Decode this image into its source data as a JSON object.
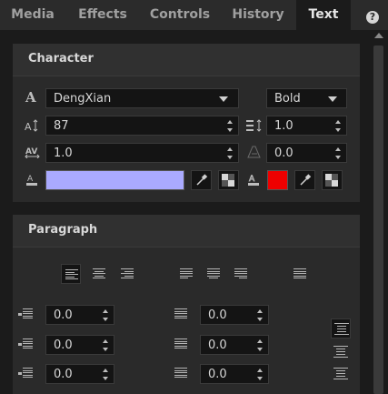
{
  "tabs": [
    {
      "label": "Media"
    },
    {
      "label": "Effects"
    },
    {
      "label": "Controls"
    },
    {
      "label": "History"
    },
    {
      "label": "Text",
      "active": true
    }
  ],
  "help_label": "?",
  "character": {
    "title": "Character",
    "font_family": "DengXian",
    "font_style": "Bold",
    "font_size": "87",
    "line_spacing": "1.0",
    "tracking": "1.0",
    "skew": "0.0",
    "fill_color": "#aaaaff",
    "stroke_color": "#ee0000"
  },
  "paragraph": {
    "title": "Paragraph",
    "indent_left": "0.0",
    "indent_right": "0.0",
    "indent_first": "0.0",
    "space_before": "0.0",
    "space_after": "0.0",
    "line_space": "0.0"
  }
}
